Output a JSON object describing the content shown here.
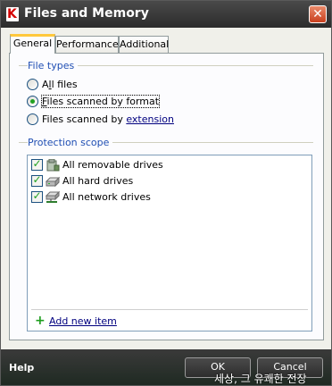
{
  "window": {
    "title": "Files and Memory",
    "app_icon_glyph": "K",
    "close_glyph": "✕",
    "accent_color": "#d40000"
  },
  "tabs": [
    {
      "label": "General",
      "active": true
    },
    {
      "label": "Performance",
      "active": false
    },
    {
      "label": "Additional",
      "active": false
    }
  ],
  "file_types": {
    "group_label": "File types",
    "options": [
      {
        "pre": "A",
        "ul": "l",
        "post": "l files",
        "selected": false
      },
      {
        "pre": "",
        "ul": "F",
        "post": "iles scanned by format",
        "selected": true
      },
      {
        "pre": "Files scanned by ",
        "link": "extension",
        "selected": false
      }
    ]
  },
  "protection_scope": {
    "group_label": "Protection scope",
    "items": [
      {
        "label": "All removable drives",
        "checked": true,
        "icon": "removable-drive-icon"
      },
      {
        "label": "All hard drives",
        "checked": true,
        "icon": "hard-drive-icon"
      },
      {
        "label": "All network drives",
        "checked": true,
        "icon": "network-drive-icon"
      }
    ],
    "add_label": "Add new item"
  },
  "footer": {
    "help_label": "Help",
    "ok_label": "OK",
    "cancel_label": "Cancel"
  },
  "watermark": "세상, 그 유쾌한 전장"
}
